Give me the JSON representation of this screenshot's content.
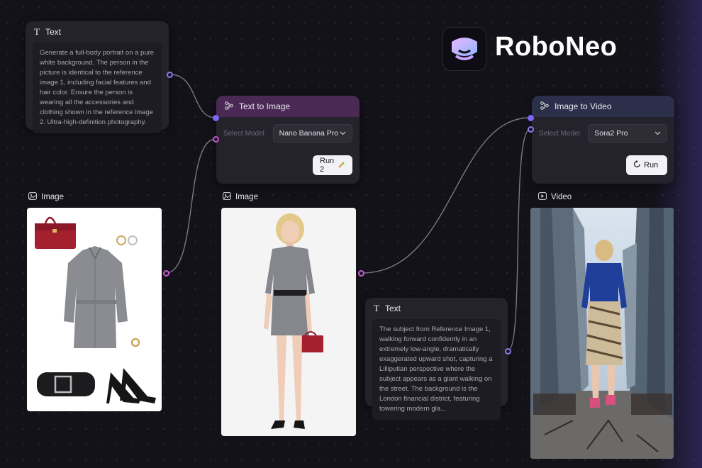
{
  "brand": {
    "name": "RoboNeo"
  },
  "nodes": {
    "prompt1": {
      "title": "Text",
      "text": "Generate a full-body portrait on a pure white background. The person in the picture is identical to the reference image 1, including facial features and hair color. Ensure the person is wearing all the accessories and clothing shown in the reference image 2. Ultra-high-definition photography."
    },
    "text_to_image": {
      "title": "Text to Image",
      "model_label": "Select Model",
      "model_value": "Nano Banana Pro",
      "run_label": "Run 2"
    },
    "image_ref": {
      "title": "Image"
    },
    "image_out": {
      "title": "Image"
    },
    "image_to_video": {
      "title": "Image to Video",
      "model_label": "Select Model",
      "model_value": "Sora2 Pro",
      "run_label": "Run"
    },
    "video": {
      "title": "Video"
    },
    "prompt2": {
      "title": "Text",
      "text": "The subject from Reference Image 1, walking forward confidently in an extremely low-angle, dramatically exaggerated upward shot, capturing a Lilliputian perspective where the subject appears as a giant walking on the street. The background is the London financial district, featuring towering modern gla..."
    }
  },
  "icons": {
    "text": "text-icon",
    "workflow": "workflow-icon",
    "image": "image-icon",
    "video": "video-icon",
    "chevron": "chevron-down-icon",
    "spark": "spark-icon",
    "refresh": "refresh-icon"
  },
  "colors": {
    "background": "#131219",
    "node": "#24232b",
    "port_purple": "#8f7cf0",
    "port_pink": "#c858d6",
    "header_text_to_image": "#4a2a55",
    "header_image_to_video": "#2c2f4a"
  }
}
